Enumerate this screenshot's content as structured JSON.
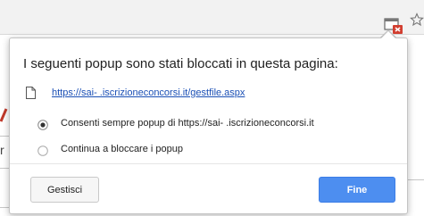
{
  "bubble": {
    "title": "I seguenti popup sono stati bloccati in questa pagina:",
    "blocked_link": "https://sai-     .iscrizioneconcorsi.it/gestfile.aspx",
    "options": [
      {
        "label": "Consenti sempre popup di https://sai-              .iscrizioneconcorsi.it",
        "selected": true
      },
      {
        "label": "Continua a bloccare i popup",
        "selected": false
      }
    ],
    "manage_label": "Gestisci",
    "done_label": "Fine"
  },
  "page": {
    "fragment_char": "r"
  },
  "icons": {
    "toolbar": [
      "popup-blocked-icon",
      "star-icon"
    ],
    "bubble": [
      "file-icon",
      "radio-icon"
    ]
  },
  "colors": {
    "accent": "#4d8ef0",
    "link": "#1a4fb5",
    "blocked_badge": "#d23f31"
  }
}
